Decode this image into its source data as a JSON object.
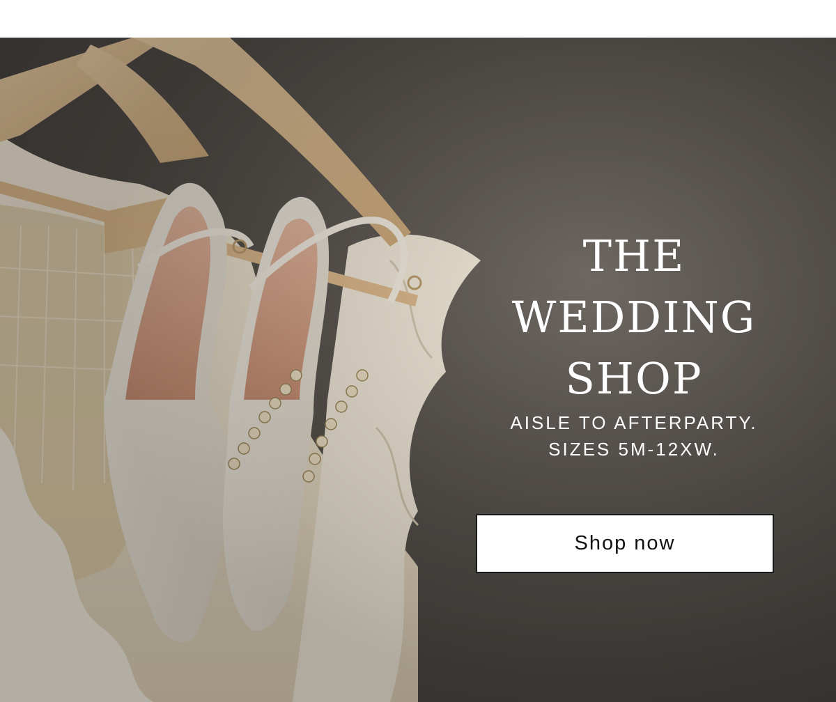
{
  "hero": {
    "headline_lines": [
      "THE",
      "WEDDING",
      "SHOP"
    ],
    "subhead_lines": [
      "AISLE TO AFTERPARTY.",
      "SIZES 5M-12XW."
    ],
    "cta_label": "Shop now",
    "image_icon": "wedding-shoes-on-hanger-photo"
  },
  "colors": {
    "background_dark": "#57524d",
    "text": "#ffffff",
    "button_bg": "#ffffff",
    "button_text": "#111111"
  }
}
